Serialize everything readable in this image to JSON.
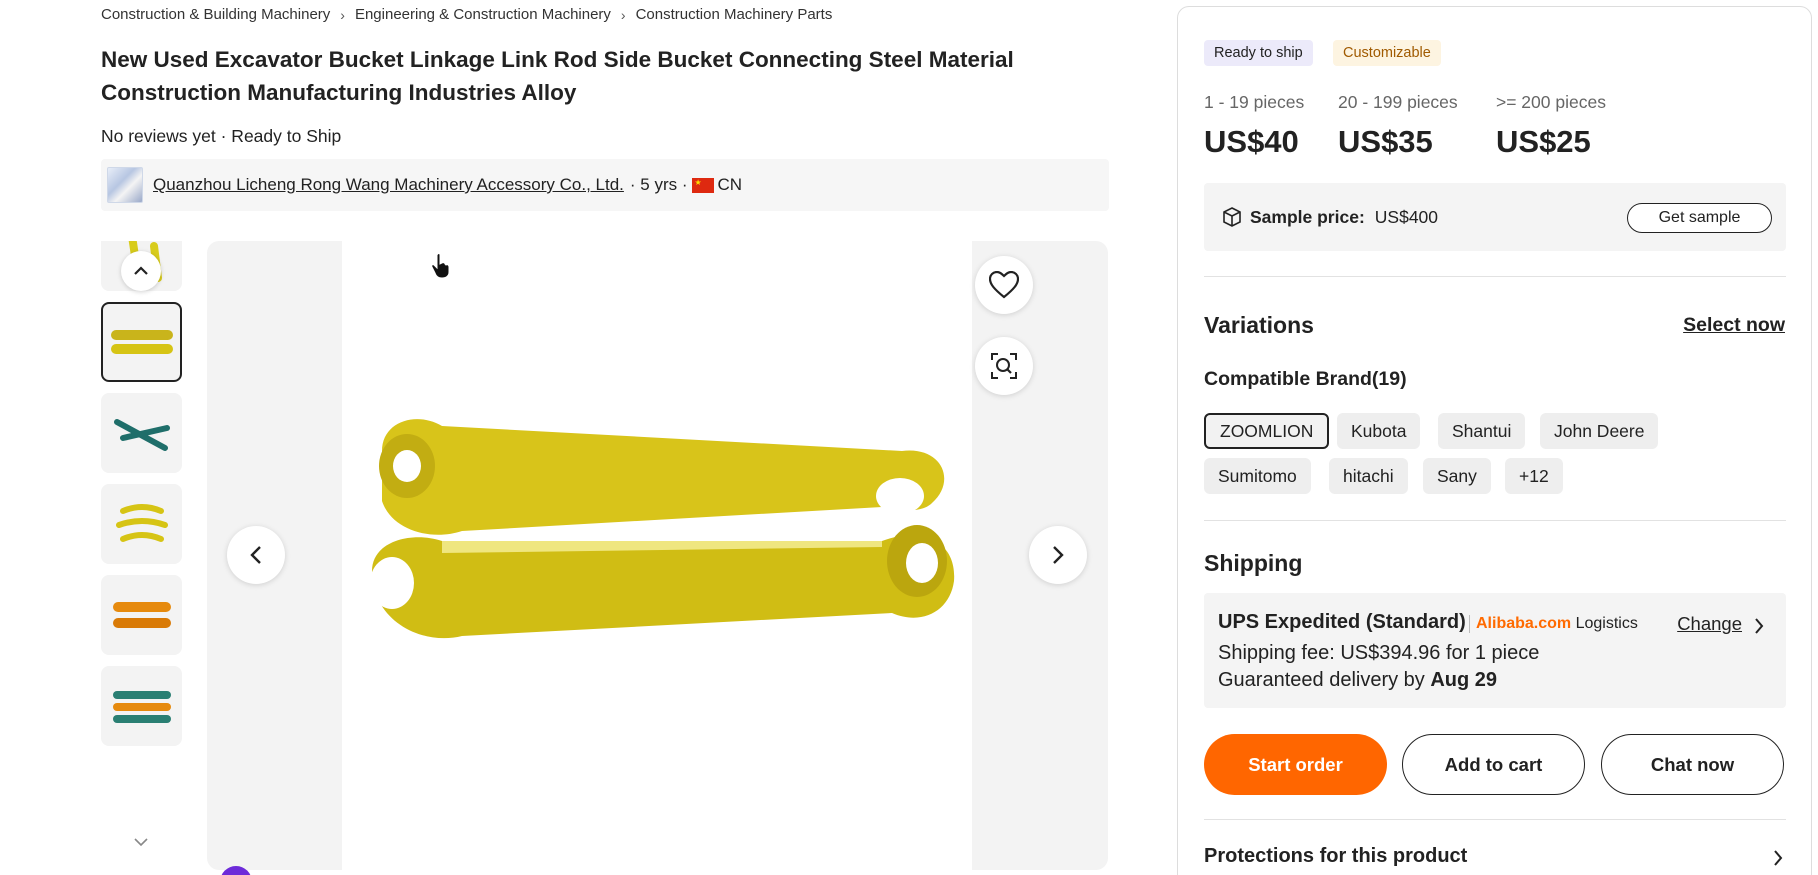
{
  "breadcrumb": [
    "Construction & Building Machinery",
    "Engineering & Construction Machinery",
    "Construction Machinery Parts"
  ],
  "product": {
    "title": "New Used Excavator Bucket Linkage Link Rod Side Bucket Connecting Steel Material Construction Manufacturing Industries Alloy",
    "reviews_line": "No reviews yet · Ready to Ship"
  },
  "supplier": {
    "name": "Quanzhou Licheng Rong Wang Machinery Accessory Co., Ltd.",
    "years": "· 5 yrs ·",
    "country": "CN"
  },
  "gallery": {
    "thumbnail_colors": [
      "#d8cc1c",
      "#c9b41b",
      "#1f6e6a",
      "#d6c414",
      "#e68a0e",
      "#2a7f73"
    ],
    "active_index": 1
  },
  "badges": {
    "ready": "Ready to ship",
    "custom": "Customizable"
  },
  "pricing": {
    "tiers": [
      {
        "range": "1 - 19 pieces",
        "price": "US$40"
      },
      {
        "range": "20 - 199 pieces",
        "price": "US$35"
      },
      {
        "range": ">= 200 pieces",
        "price": "US$25"
      }
    ],
    "sample_label": "Sample price:",
    "sample_value": "US$400",
    "get_sample": "Get sample"
  },
  "variations": {
    "title": "Variations",
    "select_now": "Select now",
    "compatible_label": "Compatible Brand(19)",
    "brands": [
      "ZOOMLION",
      "Kubota",
      "Shantui",
      "John Deere",
      "Sumitomo",
      "hitachi",
      "Sany",
      "+12"
    ],
    "selected": "ZOOMLION"
  },
  "shipping": {
    "title": "Shipping",
    "method": "UPS Expedited (Standard)",
    "logo_brand": "Alibaba.com",
    "logo_suffix": "Logistics",
    "change": "Change",
    "fee": "Shipping fee: US$394.96 for 1 piece",
    "delivery_prefix": "Guaranteed delivery by",
    "delivery_date": "Aug 29"
  },
  "actions": {
    "start": "Start order",
    "cart": "Add to cart",
    "chat": "Chat now"
  },
  "protections": "Protections for this product",
  "colors": {
    "accent": "#ff6600",
    "badge_ready_bg": "#eceafa",
    "badge_custom_text": "#a05a00"
  }
}
